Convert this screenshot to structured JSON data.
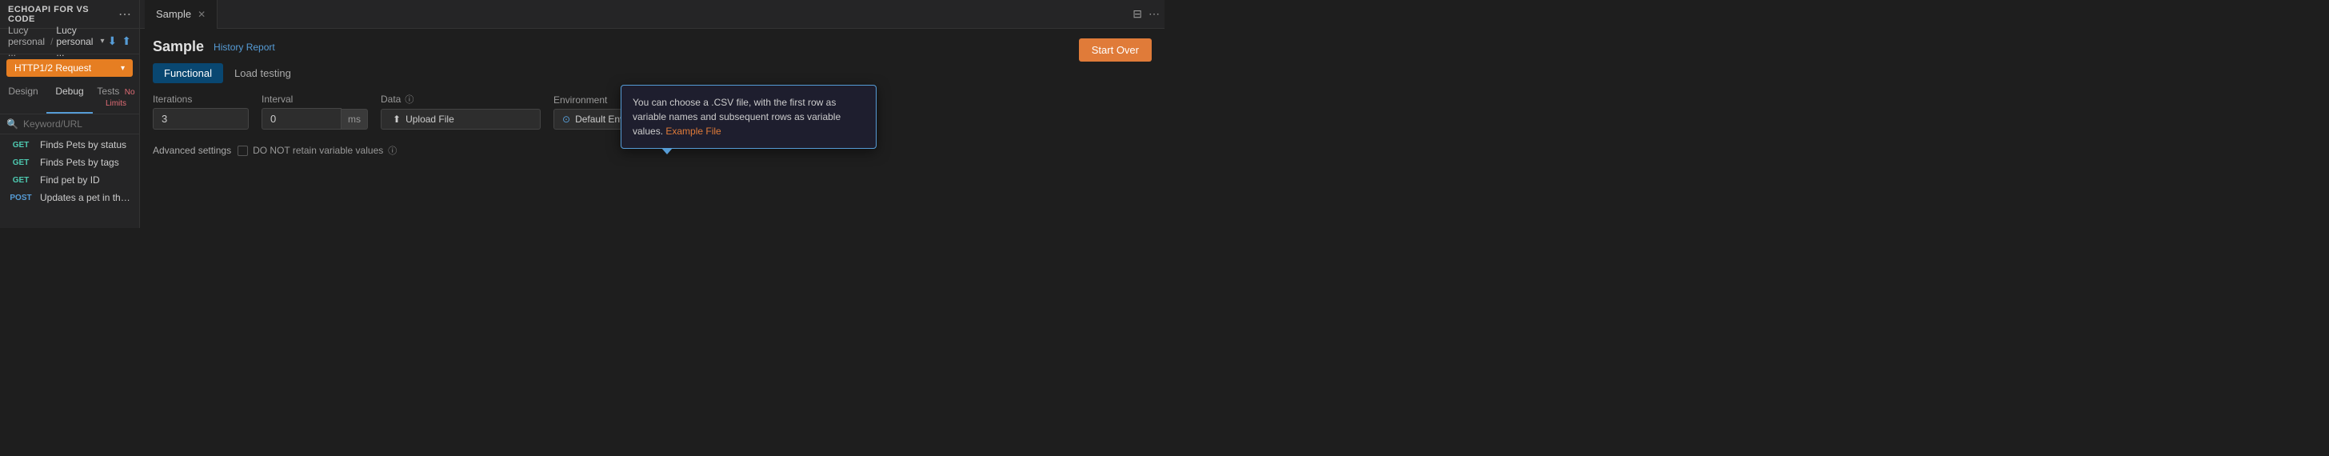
{
  "sidebar": {
    "app_title": "ECHOAPI FOR VS CODE",
    "more_icon": "⋯",
    "workspace": {
      "name1": "Lucy personal ...",
      "separator": "/",
      "name2": "Lucy personal ...",
      "caret": "▾"
    },
    "http_button_label": "HTTP1/2 Request",
    "http_button_caret": "▾",
    "tabs": [
      {
        "label": "Design",
        "active": false
      },
      {
        "label": "Debug",
        "active": true
      },
      {
        "label": "Tests",
        "active": false,
        "badge": "No Limits"
      }
    ],
    "search_placeholder": "Keyword/URL",
    "api_items": [
      {
        "method": "GET",
        "name": "Finds Pets by status"
      },
      {
        "method": "GET",
        "name": "Finds Pets by tags"
      },
      {
        "method": "GET",
        "name": "Find pet by ID"
      },
      {
        "method": "POST",
        "name": "Updates a pet in the sto..."
      }
    ]
  },
  "tab_bar": {
    "tab_label": "Sample",
    "close_icon": "✕",
    "split_icon": "⊟",
    "more_icon": "⋯"
  },
  "content": {
    "title": "Sample",
    "history_link": "History Report",
    "tabs": [
      {
        "label": "Functional",
        "active": true
      },
      {
        "label": "Load testing",
        "active": false
      }
    ],
    "form": {
      "iterations_label": "Iterations",
      "iterations_value": "3",
      "interval_label": "Interval",
      "interval_value": "0",
      "interval_unit": "ms",
      "data_label": "Data",
      "data_info_icon": "ⓘ",
      "upload_button_label": "Upload File",
      "upload_icon": "⬆",
      "environment_label": "Environment",
      "environment_value": "Default Environment",
      "env_icon": "⊙",
      "env_caret": "▾",
      "env_settings_icon": "≡",
      "advanced_label": "Advanced settings",
      "checkbox_label": "DO NOT retain variable values",
      "checkbox_info": "ⓘ"
    },
    "tooltip": {
      "text_before": "You can choose a .CSV file, with the first row as variable names and subsequent rows as variable values.",
      "link_text": "Example File"
    },
    "start_over_label": "Start Over"
  }
}
